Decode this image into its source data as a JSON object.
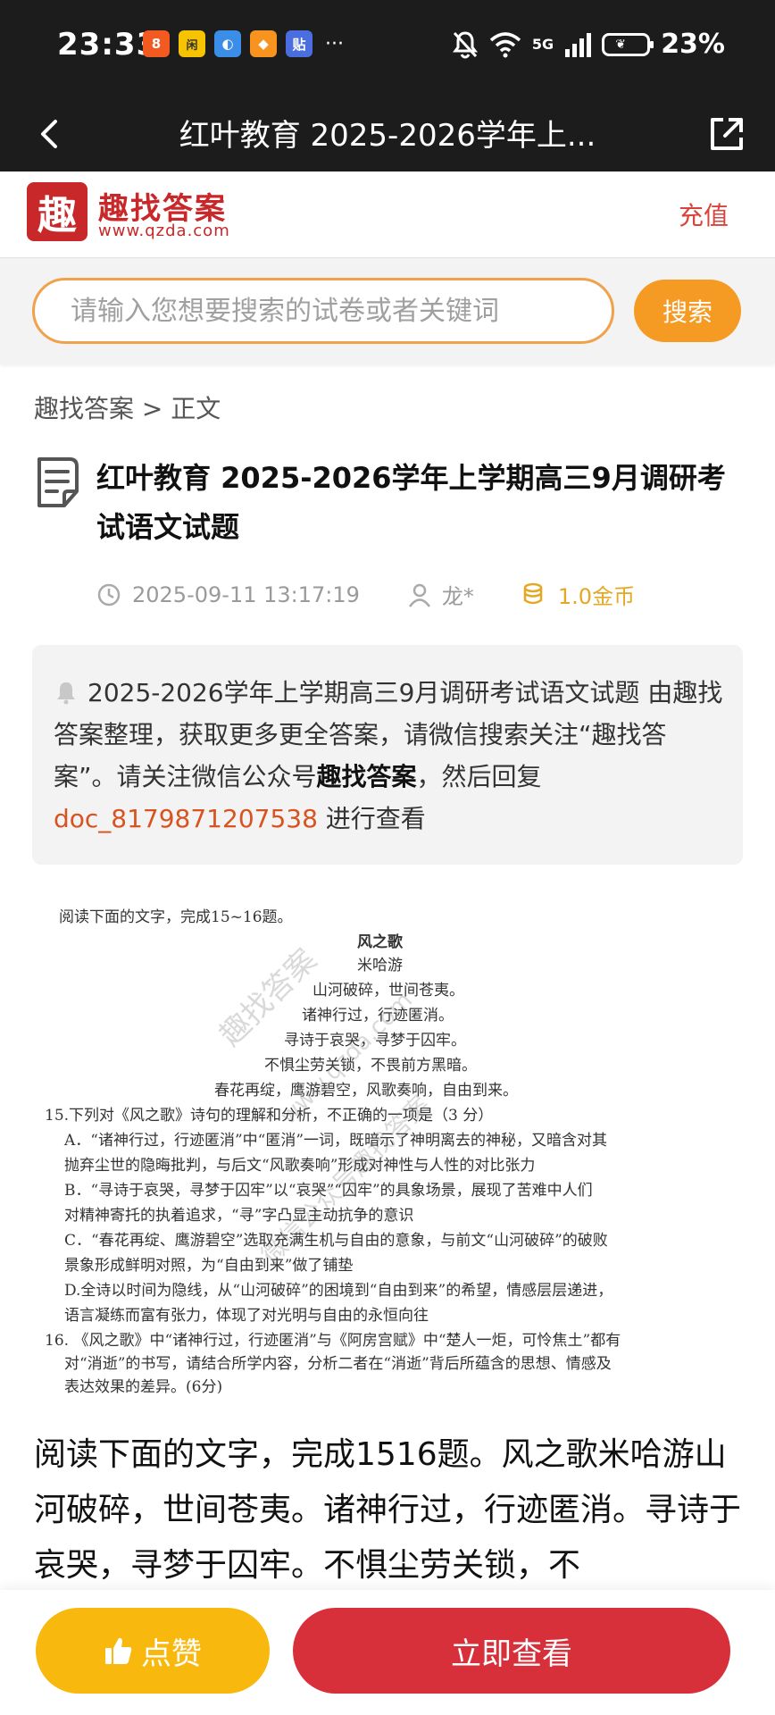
{
  "status_bar": {
    "time": "23:33",
    "app_icons": [
      {
        "name": "app-icon-1",
        "glyph": "8",
        "color": "#f25a22"
      },
      {
        "name": "app-icon-2",
        "glyph": "闲",
        "color": "#f6c300"
      },
      {
        "name": "app-icon-3",
        "glyph": "◐",
        "color": "#3b8ee8"
      },
      {
        "name": "app-icon-4",
        "glyph": "◆",
        "color": "#f7931e"
      },
      {
        "name": "app-icon-5",
        "glyph": "贴",
        "color": "#4a6ee0"
      }
    ],
    "more": "···",
    "network": "5G",
    "battery": "23%"
  },
  "header": {
    "title": "红叶教育 2025-2026学年上..."
  },
  "site": {
    "logo_char": "趣",
    "name": "趣找答案",
    "url": "www.qzda.com",
    "recharge_label": "充值"
  },
  "search": {
    "placeholder": "请输入您想要搜索的试卷或者关键词",
    "button_label": "搜索"
  },
  "breadcrumb": "趣找答案 > 正文",
  "article": {
    "title": "红叶教育 2025-2026学年上学期高三9月调研考试语文试题",
    "date": "2025-09-11 13:17:19",
    "author": "龙*",
    "price": "1.0金币"
  },
  "notice": {
    "text_1": "2025-2026学年上学期高三9月调研考试语文试题 由趣找答案整理，获取更多更全答案，请微信搜索关注“趣找答案”。请关注微信公众号",
    "highlight": "趣找答案",
    "text_2": "，然后回复",
    "code": "doc_8179871207538",
    "text_3": " 进行查看"
  },
  "exam_image": {
    "lines": [
      "阅读下面的文字，完成15~16题。",
      "风之歌",
      "米哈游",
      "山河破碎，世间苍夷。",
      "诸神行过，行迹匿消。",
      "寻诗于哀哭，寻梦于囚牢。",
      "不惧尘劳关锁，不畏前方黑暗。",
      "春花再绽，鹰游碧空，风歌奏响，自由到来。",
      "15.下列对《风之歌》诗句的理解和分析，不正确的一项是（3 分）",
      "A．“诸神行过，行迹匿消”中“匿消”一词，既暗示了神明离去的神秘，又暗含对其",
      "抛弃尘世的隐晦批判，与后文“风歌奏响”形成对神性与人性的对比张力",
      "B．“寻诗于哀哭，寻梦于囚牢”以“哀哭”“囚牢”的具象场景，展现了苦难中人们",
      "对精神寄托的执着追求，“寻”字凸显主动抗争的意识",
      "C．“春花再绽、鹰游碧空”选取充满生机与自由的意象，与前文“山河破碎”的破败",
      "景象形成鲜明对照，为“自由到来”做了铺垫",
      "D.全诗以时间为隐线，从“山河破碎”的困境到“自由到来”的希望，情感层层递进，",
      "语言凝练而富有张力，体现了对光明与自由的永恒向往",
      "16.  《风之歌》中“诸神行过，行迹匿消”与《阿房宫赋》中“楚人一炬，可怜焦土”都有",
      "对“消逝”的书写，请结合所学内容，分析二者在“消逝”背后所蕴含的思想、情感及",
      "表达效果的差异。(6分)"
    ],
    "watermarks": [
      "趣找答案",
      "www.qzda.com",
      "微信公众号趣找答案"
    ]
  },
  "body_text": "阅读下面的文字，完成1516题。风之歌米哈游山河破碎，世间苍夷。诸神行过，行迹匿消。寻诗于哀哭，寻梦于囚牢。不惧尘劳关锁，不",
  "bottom": {
    "like_label": "点赞",
    "view_label": "立即查看"
  }
}
